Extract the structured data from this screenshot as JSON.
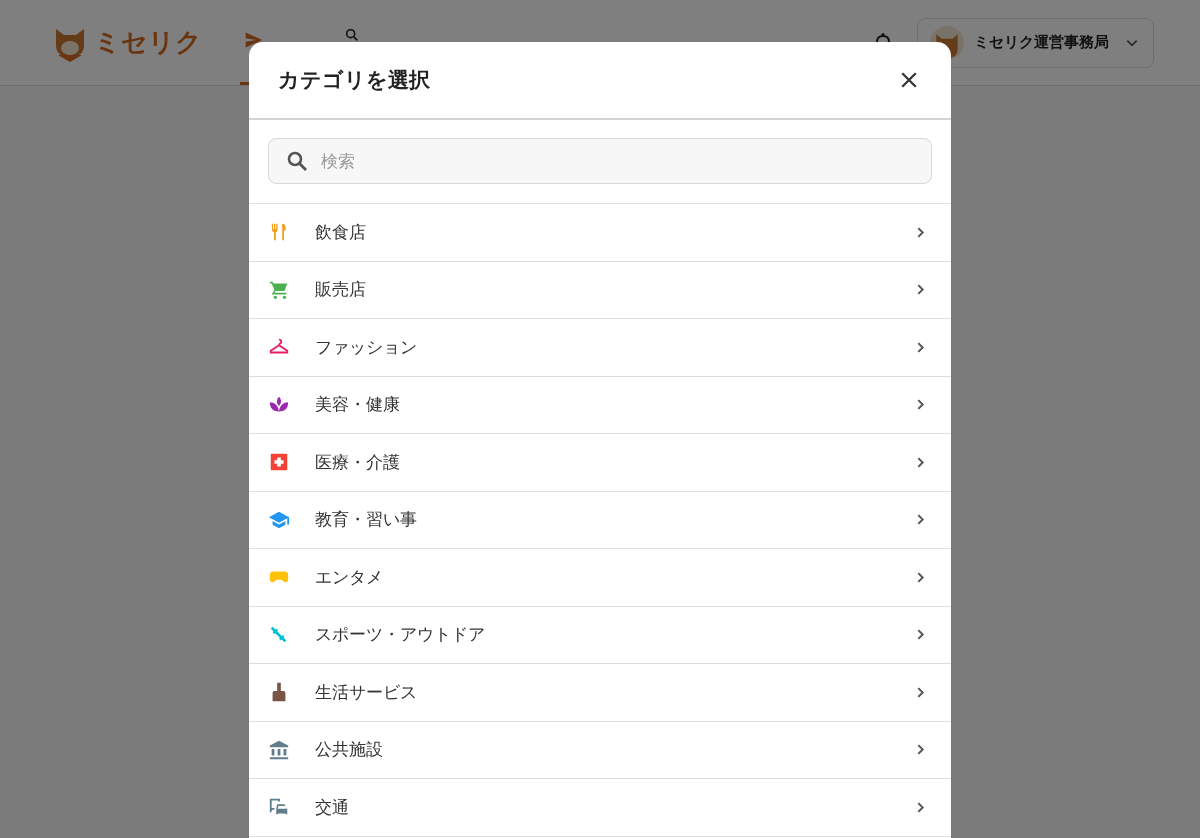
{
  "header": {
    "logo": "ミセリク",
    "nav": [
      {
        "selected": true,
        "kind": "post"
      },
      {
        "selected": false,
        "kind": "search"
      }
    ],
    "user": {
      "name": "ミセリク運営事務局"
    }
  },
  "dialog": {
    "title": "カテゴリを選択",
    "search": {
      "placeholder": "検索"
    },
    "categories": [
      {
        "label": "飲食店",
        "kind": "food",
        "color": "#f59c1a"
      },
      {
        "label": "販売店",
        "kind": "shop",
        "color": "#4caf50"
      },
      {
        "label": "ファッション",
        "kind": "fashion",
        "color": "#e91e63"
      },
      {
        "label": "美容・健康",
        "kind": "beauty",
        "color": "#9c27b0"
      },
      {
        "label": "医療・介護",
        "kind": "medical",
        "color": "#f44336"
      },
      {
        "label": "教育・習い事",
        "kind": "education",
        "color": "#2196f3"
      },
      {
        "label": "エンタメ",
        "kind": "entertainment",
        "color": "#ffc107"
      },
      {
        "label": "スポーツ・アウトドア",
        "kind": "sports",
        "color": "#00bcd4"
      },
      {
        "label": "生活サービス",
        "kind": "life",
        "color": "#795548"
      },
      {
        "label": "公共施設",
        "kind": "public",
        "color": "#607d8b"
      },
      {
        "label": "交通",
        "kind": "transport",
        "color": "#607d8b"
      }
    ]
  }
}
